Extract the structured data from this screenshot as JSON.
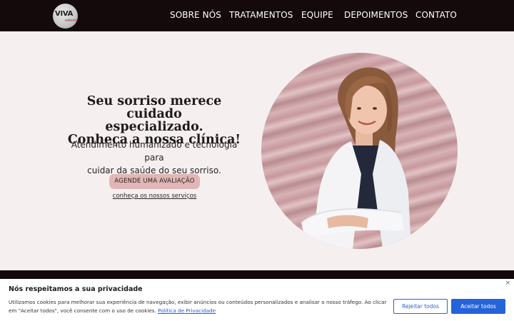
{
  "header": {
    "logo": {
      "main": "VIVA",
      "sub": "odonto",
      "icon": "viva-logo"
    },
    "nav": [
      {
        "label": "SOBRE NÓS"
      },
      {
        "label": "TRATAMENTOS"
      },
      {
        "label": "EQUIPE"
      },
      {
        "label": "DEPOIMENTOS"
      },
      {
        "label": "CONTATO"
      }
    ]
  },
  "hero": {
    "title_line1": "Seu sorriso merece cuidado",
    "title_line2": "especializado.",
    "title_line3": "Conheça a nossa clínica!",
    "subtitle_line1": "Atendimento humanizado e tecnologia para",
    "subtitle_line2": "cuidar da saúde do seu sorriso.",
    "cta_label": "AGENDE UMA AVALIAÇÃO",
    "services_link": "conheça os nossos serviços",
    "photo_icon": "dentist-portrait-photo"
  },
  "cookie": {
    "title": "Nós respeitamos a sua privacidade",
    "text": "Utilizamos cookies para melhorar sua experiência de navegação, exibir anúncios ou conteúdos personalizados e analisar o nosso tráfego. Ao clicar em \"Aceitar todos\", você consente com o uso de cookies.",
    "privacy_link": "Política de Privacidade",
    "reject_label": "Rejeitar todos",
    "accept_label": "Aceitar todos",
    "close_glyph": "×"
  },
  "colors": {
    "header_bg": "#140a0c",
    "page_bg": "#f5f0ef",
    "cta_bg": "#e0b6b6",
    "accept_bg": "#2563d9",
    "link": "#1f5fd1"
  }
}
